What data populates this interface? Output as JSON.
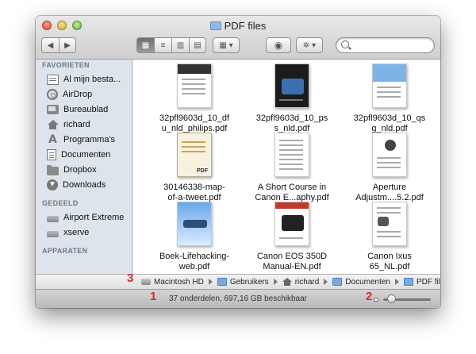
{
  "window": {
    "title": "PDF files"
  },
  "toolbar": {
    "back_icon": "chevron-left-icon",
    "forward_icon": "chevron-right-icon",
    "views": [
      "icon-view",
      "list-view",
      "column-view",
      "coverflow-view"
    ],
    "arrange_icon": "arrange-icon",
    "quicklook_icon": "eye-icon",
    "action_icon": "gear-icon",
    "search_placeholder": ""
  },
  "sidebar": {
    "favorites_header": "FAVORIETEN",
    "favorites": [
      {
        "label": "Al mijn besta...",
        "icon": "all-files-icon"
      },
      {
        "label": "AirDrop",
        "icon": "airdrop-icon"
      },
      {
        "label": "Bureaublad",
        "icon": "desktop-icon"
      },
      {
        "label": "richard",
        "icon": "home-icon"
      },
      {
        "label": "Programma's",
        "icon": "applications-icon"
      },
      {
        "label": "Documenten",
        "icon": "documents-icon"
      },
      {
        "label": "Dropbox",
        "icon": "folder-icon"
      },
      {
        "label": "Downloads",
        "icon": "downloads-icon"
      }
    ],
    "shared_header": "GEDEELD",
    "shared": [
      {
        "label": "Airport Extreme",
        "icon": "drive-icon"
      },
      {
        "label": "xserve",
        "icon": "drive-icon"
      }
    ],
    "devices_header": "APPARATEN"
  },
  "files": [
    {
      "line1": "32pfl9603d_10_df",
      "line2": "u_nld_philips.pdf"
    },
    {
      "line1": "32pfl9603d_10_ps",
      "line2": "s_nld.pdf"
    },
    {
      "line1": "32pfl9603d_10_qs",
      "line2": "g_nld.pdf"
    },
    {
      "line1": "30146338-map-",
      "line2": "of-a-tweet.pdf"
    },
    {
      "line1": "A Short Course in",
      "line2": "Canon E...aphy.pdf"
    },
    {
      "line1": "Aperture",
      "line2": "Adjustm....5.2.pdf"
    },
    {
      "line1": "Boek-Lifehacking-",
      "line2": "web.pdf"
    },
    {
      "line1": "Canon EOS 350D",
      "line2": "Manual-EN.pdf"
    },
    {
      "line1": "Canon Ixus",
      "line2": "65_NL.pdf"
    }
  ],
  "pathbar": [
    "Macintosh HD",
    "Gebruikers",
    "richard",
    "Documenten",
    "PDF files"
  ],
  "status": {
    "text": "37 onderdelen, 697,16 GB beschikbaar",
    "icon_size_fraction": 0.1
  },
  "callouts": {
    "one": "1",
    "two": "2",
    "three": "3"
  },
  "colors": {
    "callout": "#e02626",
    "sidebar_bg": "#dde4ec"
  }
}
